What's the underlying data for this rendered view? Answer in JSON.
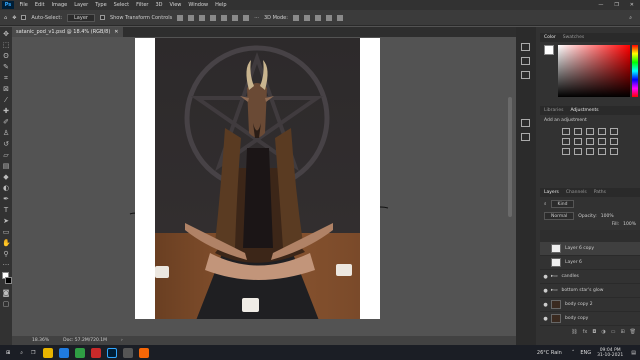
{
  "menu": {
    "items": [
      "File",
      "Edit",
      "Image",
      "Layer",
      "Type",
      "Select",
      "Filter",
      "3D",
      "View",
      "Window",
      "Help"
    ],
    "window_controls": [
      "—",
      "❐",
      "✕"
    ]
  },
  "options": {
    "auto_select_label": "Auto-Select:",
    "auto_select_value": "Layer",
    "transform_label": "Show Transform Controls",
    "mode_3d": "3D Mode:"
  },
  "document": {
    "tab_title": "satanic_pod_v1.psd @ 18.4% (RGB/8)",
    "tab_close": "✕"
  },
  "status": {
    "zoom": "18.36%",
    "doc_size": "Doc: 57.2M/720.1M"
  },
  "color_panel": {
    "tabs": [
      "Color",
      "Swatches"
    ],
    "fg_color": "#ffffff"
  },
  "adjust_panel": {
    "tabs": [
      "Libraries",
      "Adjustments"
    ],
    "hint": "Add an adjustment"
  },
  "layers_panel": {
    "tabs": [
      "Layers",
      "Channels",
      "Paths"
    ],
    "kind": "Kind",
    "blend": "Normal",
    "opacity_label": "Opacity:",
    "opacity": "100%",
    "fill_label": "Fill:",
    "fill": "100%",
    "layers": [
      {
        "name": "Layer 6 copy",
        "visible": false,
        "selected": true
      },
      {
        "name": "Layer 6",
        "visible": false,
        "selected": false
      },
      {
        "name": "candles",
        "visible": true,
        "selected": false,
        "folder": true
      },
      {
        "name": "bottom star's glow",
        "visible": true,
        "selected": false,
        "folder": true
      },
      {
        "name": "body copy 2",
        "visible": true,
        "selected": false
      },
      {
        "name": "body copy",
        "visible": true,
        "selected": false
      }
    ]
  },
  "taskbar": {
    "weather": "26°C  Rain",
    "lang": "ENG",
    "time": "09:04 PM",
    "date": "31-10-2021"
  }
}
